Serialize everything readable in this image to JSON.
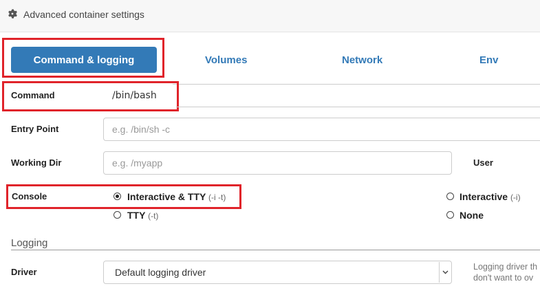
{
  "header": {
    "title": "Advanced container settings",
    "icon": "gear-icon"
  },
  "tabs": [
    {
      "label": "Command & logging",
      "active": true
    },
    {
      "label": "Volumes"
    },
    {
      "label": "Network"
    },
    {
      "label": "Env"
    }
  ],
  "fields": {
    "command": {
      "label": "Command",
      "value": "/bin/bash"
    },
    "entry_point": {
      "label": "Entry Point",
      "placeholder": "e.g. /bin/sh -c"
    },
    "working_dir": {
      "label": "Working Dir",
      "placeholder": "e.g. /myapp"
    },
    "user": {
      "label": "User"
    }
  },
  "console": {
    "label": "Console",
    "options": [
      {
        "label": "Interactive & TTY",
        "flag": "(-i -t)",
        "checked": true
      },
      {
        "label": "Interactive",
        "flag": "(-i)",
        "checked": false
      },
      {
        "label": "TTY",
        "flag": "(-t)",
        "checked": false
      },
      {
        "label": "None",
        "flag": "",
        "checked": false
      }
    ]
  },
  "logging": {
    "section_title": "Logging",
    "driver_label": "Driver",
    "driver_value": "Default logging driver",
    "help_line1": "Logging driver th",
    "help_line2": "don't want to ov"
  },
  "colors": {
    "accent": "#337ab7",
    "highlight": "#e0232a"
  }
}
